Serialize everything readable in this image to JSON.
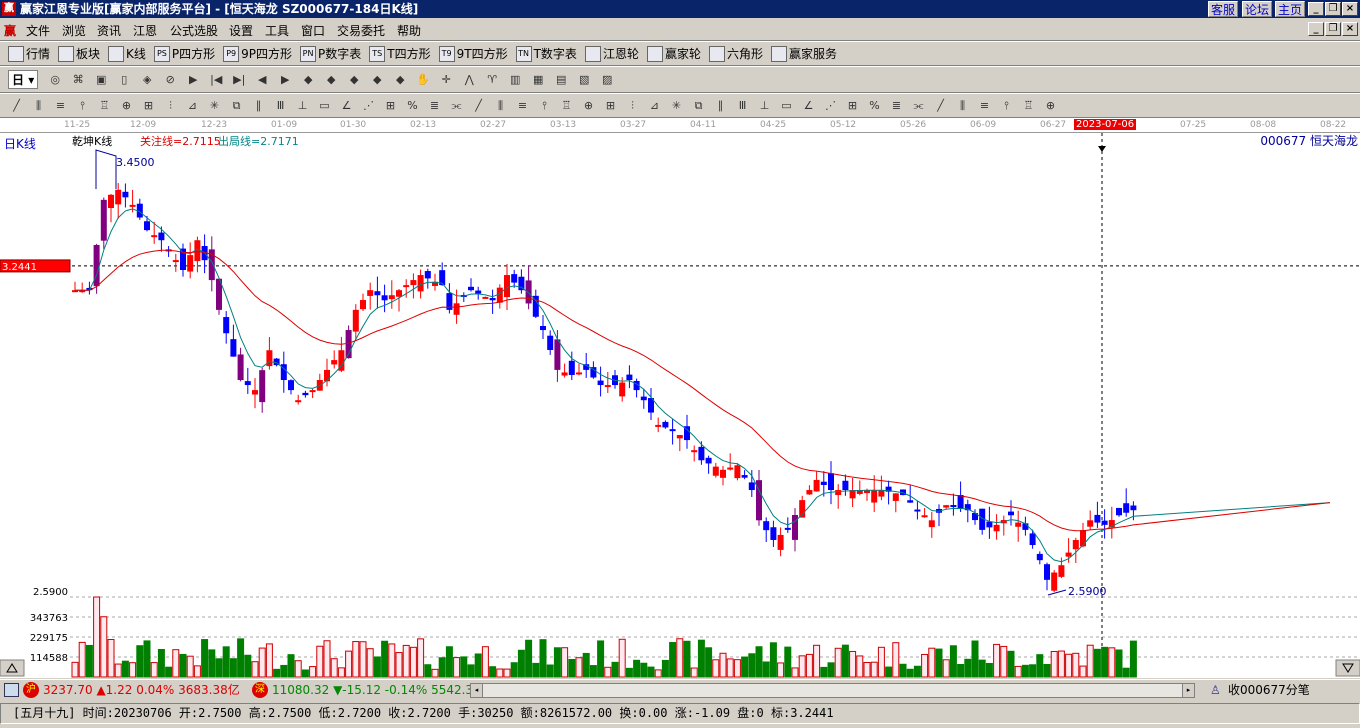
{
  "title": "赢家江恩专业版[赢家内部服务平台] - [恒天海龙   SZ000677-184日K线]",
  "title_links": [
    "客服",
    "论坛",
    "主页"
  ],
  "menu": [
    "文件",
    "浏览",
    "资讯",
    "江恩",
    "公式选股",
    "设置",
    "工具",
    "窗口",
    "交易委托",
    "帮助"
  ],
  "toolbar1": [
    "行情",
    "板块",
    "K线",
    "P四方形",
    "9P四方形",
    "P数字表",
    "T四方形",
    "9T四方形",
    "T数字表",
    "江恩轮",
    "赢家轮",
    "六角形",
    "赢家服务"
  ],
  "toolbar1_icons": [
    "",
    "",
    "",
    "PS",
    "P9",
    "PN",
    "TS",
    "T9",
    "TN",
    "",
    "",
    "",
    ""
  ],
  "period_select": "日",
  "axis": {
    "dates": [
      "11-25",
      "12-09",
      "12-23",
      "01-09",
      "01-30",
      "02-13",
      "02-27",
      "03-13",
      "03-27",
      "04-11",
      "04-25",
      "05-12",
      "05-26",
      "06-09",
      "06-27",
      "07-25",
      "08-08",
      "08-22"
    ],
    "cursor_date": "2023-07-06"
  },
  "chart": {
    "period_label": "日K线",
    "indicator_name": "乾坤K线",
    "focus_line": "关注线=2.7115",
    "exit_line": "出局线=2.7171",
    "stock_label": "000677  恒天海龙",
    "high_label": "3.4500",
    "low_label": "2.5900",
    "cursor_price": "3.2441",
    "lower_axis": [
      "2.5900",
      "343763",
      "229175",
      "114588"
    ],
    "colors": {
      "up": "#ff0000",
      "down": "#0000ff",
      "special": "#800080",
      "ma_fast": "#008080",
      "ma_slow": "#dd0000"
    }
  },
  "chart_data": {
    "type": "candlestick",
    "price_range": [
      2.59,
      3.45
    ],
    "close_keypoints": [
      [
        0,
        3.196
      ],
      [
        2,
        3.196
      ],
      [
        4,
        3.375
      ],
      [
        6,
        3.395
      ],
      [
        8,
        3.365
      ],
      [
        10,
        3.315
      ],
      [
        12,
        3.295
      ],
      [
        15,
        3.236
      ],
      [
        17,
        3.295
      ],
      [
        19,
        3.216
      ],
      [
        20,
        3.157
      ],
      [
        23,
        3.018
      ],
      [
        25,
        2.998
      ],
      [
        27,
        3.077
      ],
      [
        29,
        3.018
      ],
      [
        31,
        2.978
      ],
      [
        33,
        2.998
      ],
      [
        35,
        3.038
      ],
      [
        37,
        3.077
      ],
      [
        39,
        3.157
      ],
      [
        41,
        3.196
      ],
      [
        43,
        3.176
      ],
      [
        45,
        3.196
      ],
      [
        48,
        3.226
      ],
      [
        51,
        3.206
      ],
      [
        52,
        3.157
      ],
      [
        55,
        3.196
      ],
      [
        58,
        3.176
      ],
      [
        60,
        3.226
      ],
      [
        62,
        3.196
      ],
      [
        65,
        3.117
      ],
      [
        67,
        3.038
      ],
      [
        69,
        3.028
      ],
      [
        71,
        3.038
      ],
      [
        73,
        3.008
      ],
      [
        75,
        3.008
      ],
      [
        77,
        3.018
      ],
      [
        79,
        2.978
      ],
      [
        81,
        2.929
      ],
      [
        83,
        2.919
      ],
      [
        85,
        2.899
      ],
      [
        87,
        2.859
      ],
      [
        90,
        2.84
      ],
      [
        92,
        2.849
      ],
      [
        94,
        2.8
      ],
      [
        95,
        2.74
      ],
      [
        97,
        2.701
      ],
      [
        99,
        2.721
      ],
      [
        101,
        2.78
      ],
      [
        103,
        2.82
      ],
      [
        105,
        2.8
      ],
      [
        107,
        2.8
      ],
      [
        109,
        2.8
      ],
      [
        112,
        2.8
      ],
      [
        115,
        2.79
      ],
      [
        117,
        2.76
      ],
      [
        119,
        2.74
      ],
      [
        121,
        2.77
      ],
      [
        124,
        2.76
      ],
      [
        126,
        2.721
      ],
      [
        128,
        2.731
      ],
      [
        130,
        2.75
      ],
      [
        132,
        2.721
      ],
      [
        134,
        2.661
      ],
      [
        135,
        2.622
      ],
      [
        137,
        2.651
      ],
      [
        139,
        2.701
      ],
      [
        141,
        2.74
      ],
      [
        143,
        2.731
      ],
      [
        145,
        2.75
      ],
      [
        147,
        2.76
      ]
    ],
    "volume_range": [
      0,
      458000
    ]
  },
  "status": {
    "sh_label": "沪",
    "sh": "3237.70 ▲1.22 0.04% 3683.38亿",
    "sz_label": "深",
    "sz": "11080.32 ▼-15.12 -0.14% 5542.3",
    "tick": "收000677分笔"
  },
  "info": "[五月十九] 时间:20230706 开:2.7500 高:2.7500 低:2.7200 收:2.7200 手:30250 额:8261572.00 换:0.00 涨:-1.09 盘:0 标:3.2441"
}
